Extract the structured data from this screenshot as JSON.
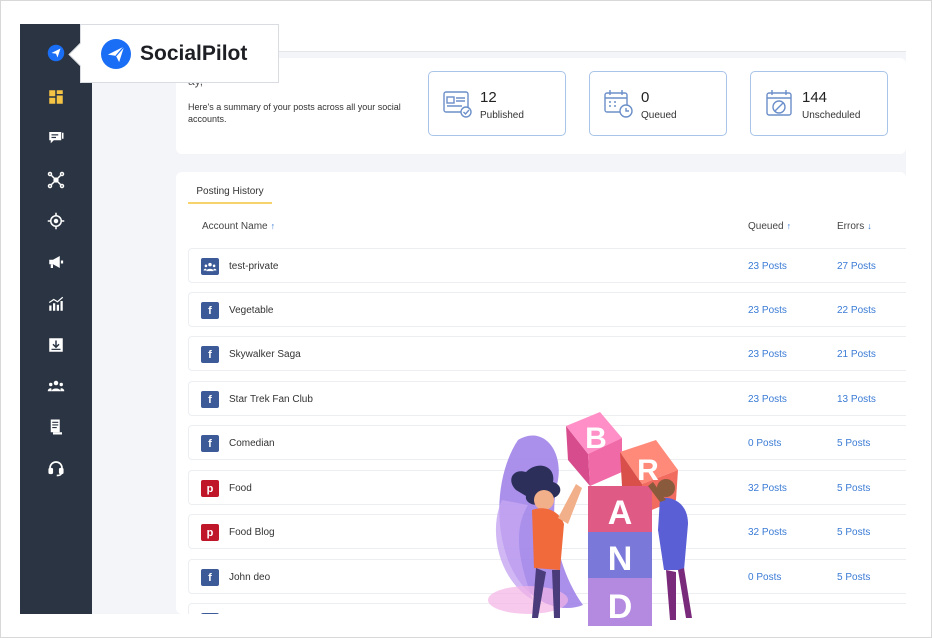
{
  "app": {
    "name": "SocialPilot",
    "brand_color": "#1a6ef5"
  },
  "sidebar": {
    "items": [
      {
        "icon": "paper-plane-icon"
      },
      {
        "icon": "dashboard-icon"
      },
      {
        "icon": "chat-icon"
      },
      {
        "icon": "network-icon"
      },
      {
        "icon": "target-icon"
      },
      {
        "icon": "megaphone-icon"
      },
      {
        "icon": "analytics-icon"
      },
      {
        "icon": "download-icon"
      },
      {
        "icon": "team-icon"
      },
      {
        "icon": "document-icon"
      },
      {
        "icon": "headset-icon"
      }
    ]
  },
  "summary": {
    "title_partial": "ay,",
    "description": "Here's a summary of your posts across all your social accounts.",
    "stats": [
      {
        "value": "12",
        "label": "Published",
        "icon": "published-icon"
      },
      {
        "value": "0",
        "label": "Queued",
        "icon": "calendar-clock-icon"
      },
      {
        "value": "144",
        "label": "Unscheduled",
        "icon": "unscheduled-icon"
      }
    ]
  },
  "history": {
    "tab_label": "Posting History",
    "columns": {
      "account": "Account Name",
      "queued": "Queued",
      "errors": "Errors"
    },
    "sort_up": "↑",
    "sort_down": "↓",
    "rows": [
      {
        "network": "group",
        "name": "test-private",
        "queued": "23 Posts",
        "errors": "27 Posts"
      },
      {
        "network": "facebook",
        "name": "Vegetable",
        "queued": "23 Posts",
        "errors": "22 Posts"
      },
      {
        "network": "facebook",
        "name": "Skywalker Saga",
        "queued": "23 Posts",
        "errors": "21 Posts"
      },
      {
        "network": "facebook",
        "name": "Star Trek Fan Club",
        "queued": "23 Posts",
        "errors": "13 Posts"
      },
      {
        "network": "facebook",
        "name": "Comedian",
        "queued": "0 Posts",
        "errors": "5 Posts"
      },
      {
        "network": "pinterest",
        "name": "Food",
        "queued": "32 Posts",
        "errors": "5 Posts"
      },
      {
        "network": "pinterest",
        "name": "Food Blog",
        "queued": "32 Posts",
        "errors": "5 Posts"
      },
      {
        "network": "facebook",
        "name": "John deo",
        "queued": "0 Posts",
        "errors": "5 Posts"
      }
    ]
  },
  "illustration": {
    "letters": [
      "B",
      "R",
      "A",
      "N",
      "D"
    ]
  }
}
